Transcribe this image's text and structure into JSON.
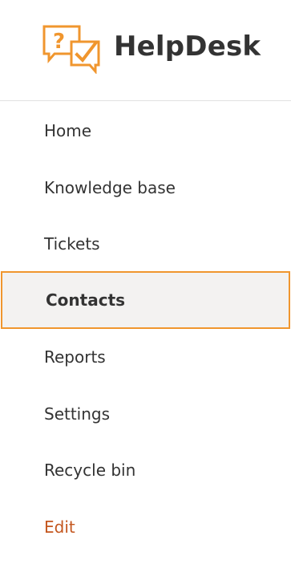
{
  "app": {
    "title": "HelpDesk",
    "logo_icon": "speech-bubbles-question-check-icon",
    "accent_color": "#f0962e"
  },
  "nav": {
    "items": [
      {
        "label": "Home",
        "selected": false
      },
      {
        "label": "Knowledge base",
        "selected": false
      },
      {
        "label": "Tickets",
        "selected": false
      },
      {
        "label": "Contacts",
        "selected": true
      },
      {
        "label": "Reports",
        "selected": false
      },
      {
        "label": "Settings",
        "selected": false
      },
      {
        "label": "Recycle bin",
        "selected": false
      }
    ],
    "edit_label": "Edit",
    "edit_color": "#c4561e",
    "selected_background": "#f3f2f1"
  }
}
